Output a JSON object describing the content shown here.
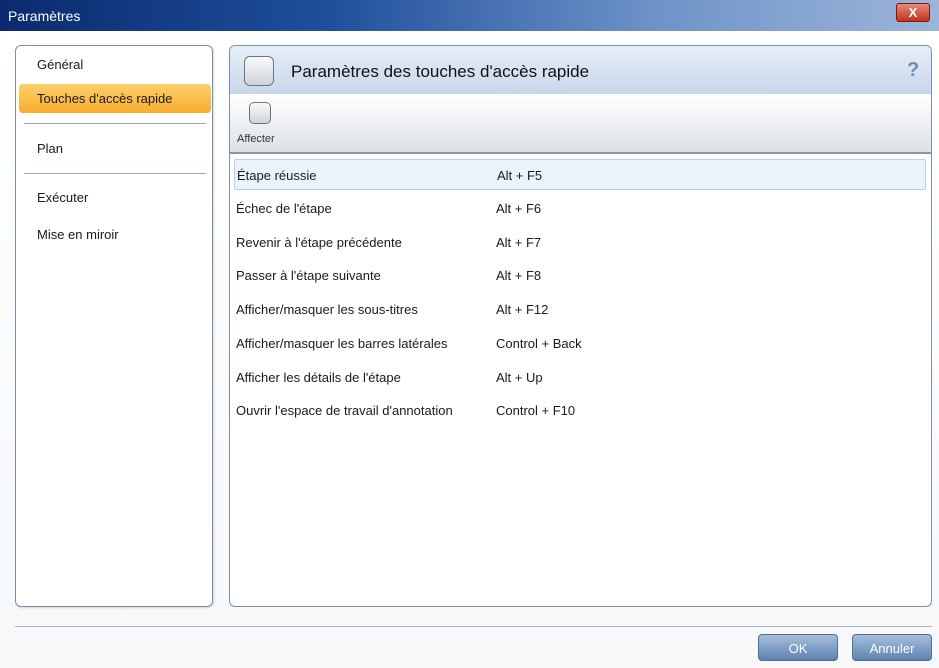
{
  "window": {
    "title": "Paramètres",
    "close_label": "X"
  },
  "sidebar": {
    "items": [
      {
        "label": "Général"
      },
      {
        "label": "Touches d'accès rapide"
      },
      {
        "label": "Plan"
      },
      {
        "label": "Exécuter"
      },
      {
        "label": "Mise en miroir"
      }
    ],
    "active_index": 1
  },
  "panel": {
    "title": "Paramètres des touches d'accès rapide",
    "help_label": "?",
    "toolbar": {
      "assign_label": "Affecter"
    },
    "shortcuts": [
      {
        "name": "Étape réussie",
        "key": "Alt + F5"
      },
      {
        "name": "Échec de l'étape",
        "key": "Alt + F6"
      },
      {
        "name": "Revenir à l'étape précédente",
        "key": "Alt + F7"
      },
      {
        "name": "Passer à l'étape suivante",
        "key": "Alt + F8"
      },
      {
        "name": "Afficher/masquer les sous-titres",
        "key": "Alt + F12"
      },
      {
        "name": "Afficher/masquer les barres latérales",
        "key": "Control + Back"
      },
      {
        "name": "Afficher les détails de l'étape",
        "key": "Alt + Up"
      },
      {
        "name": "Ouvrir l'espace de travail d'annotation",
        "key": "Control + F10"
      }
    ],
    "selected_index": 0
  },
  "footer": {
    "ok_label": "OK",
    "cancel_label": "Annuler"
  },
  "colors": {
    "accent_active": "#f8ad2c",
    "selection": "#eaf3fc",
    "button": "#5d82b2"
  }
}
